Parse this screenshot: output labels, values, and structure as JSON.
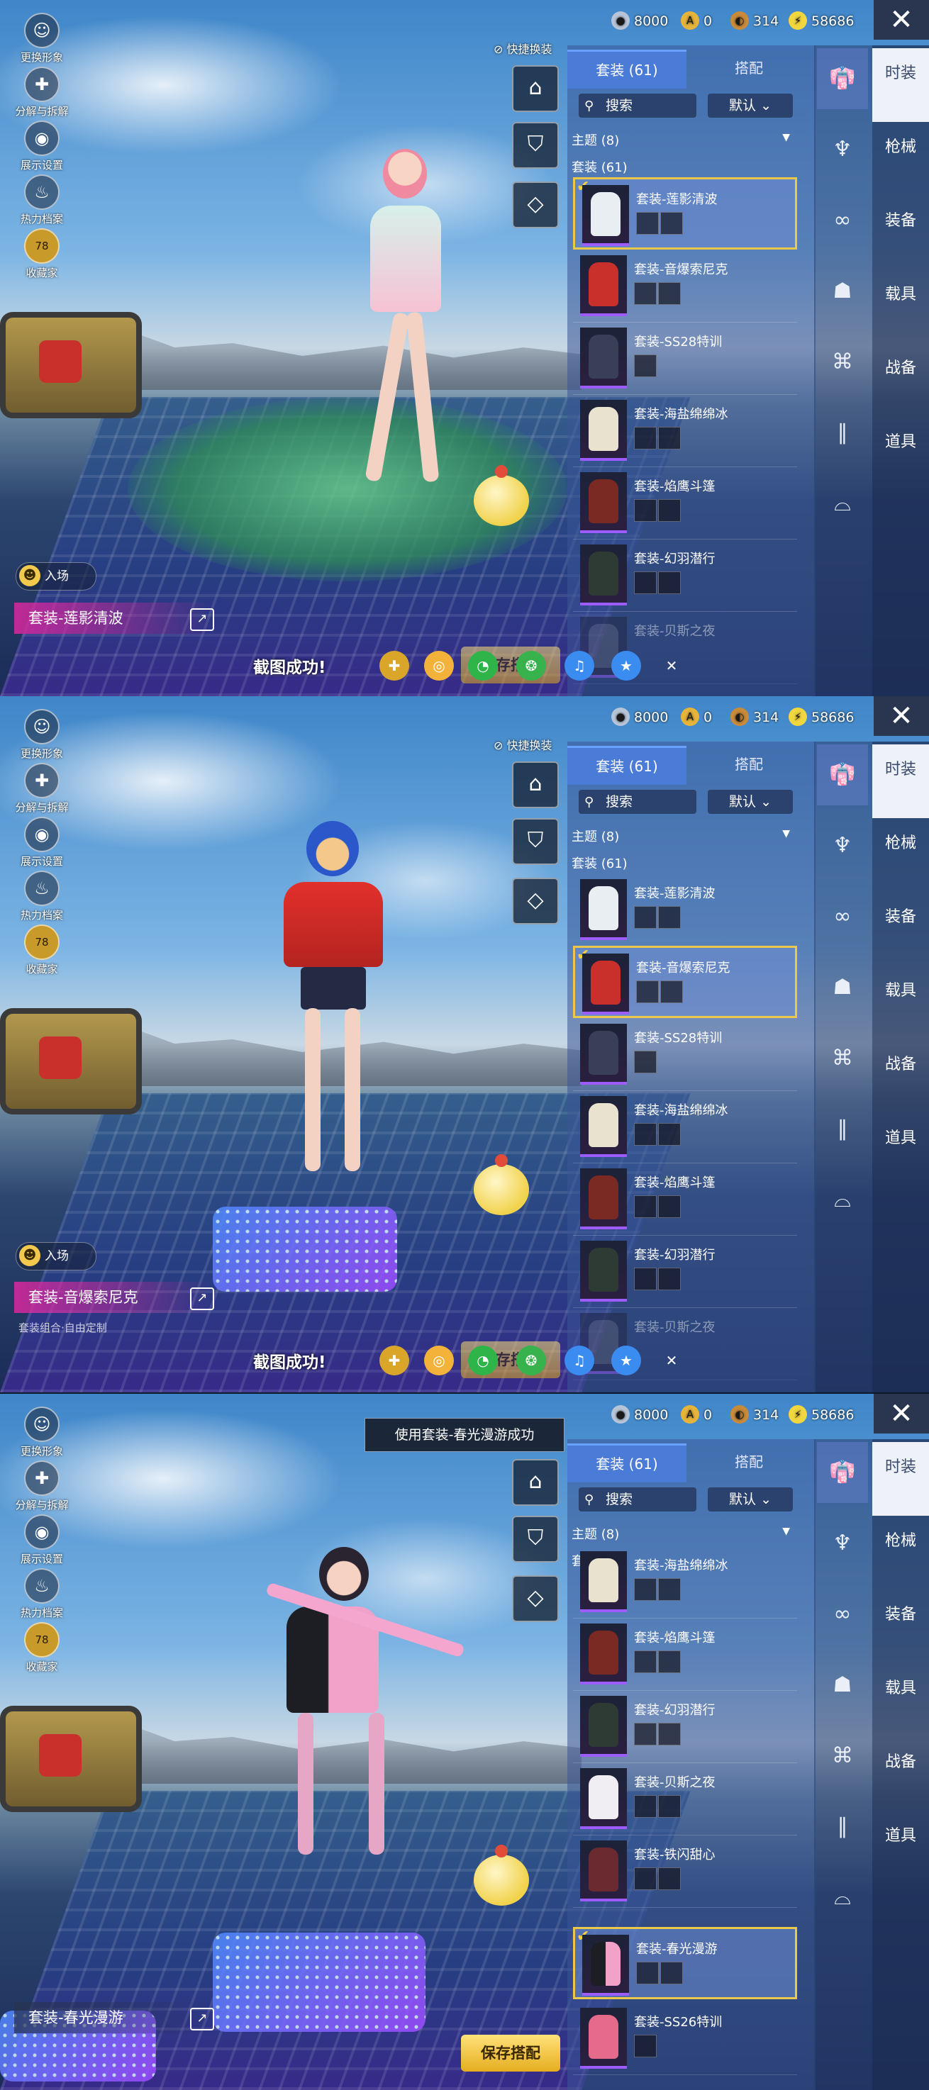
{
  "currency": {
    "coin": "8000",
    "badge": "0",
    "bronze": "314",
    "bolt": "58686"
  },
  "left_menu": [
    "更换形象",
    "分解与拆解",
    "展示设置",
    "热力档案",
    "收藏家"
  ],
  "collector_level": "78",
  "entry_label": "入场",
  "quick_change": "快捷换装",
  "tabs": [
    "套装 (61)",
    "搭配"
  ],
  "search_placeholder": "搜索",
  "sort_label": "默认",
  "theme_label": "主题 (8)",
  "suit_header": "套装 (61)",
  "side_nav": [
    "时装",
    "枪械",
    "装备",
    "载具",
    "战备",
    "道具"
  ],
  "screenshot_toast": "截图成功!",
  "save_label": "保存搭配",
  "success_toast": "使用套装-春光漫游成功",
  "subdesc": "套装组合·自由定制",
  "panels": [
    {
      "current_suit": "套装-莲影清波",
      "items": [
        "套装-莲影清波",
        "套装-音爆索尼克",
        "套装-SS28特训",
        "套装-海盐绵绵冰",
        "套装-焰鹰斗篷",
        "套装-幻羽潜行",
        "套装-贝斯之夜"
      ]
    },
    {
      "current_suit": "套装-音爆索尼克",
      "items": [
        "套装-莲影清波",
        "套装-音爆索尼克",
        "套装-SS28特训",
        "套装-海盐绵绵冰",
        "套装-焰鹰斗篷",
        "套装-幻羽潜行",
        "套装-贝斯之夜"
      ]
    },
    {
      "current_suit": "套装-春光漫游",
      "items": [
        "套装-海盐绵绵冰",
        "套装-焰鹰斗篷",
        "套装-幻羽潜行",
        "套装-贝斯之夜",
        "套装-铁闪甜心",
        "套装-春光漫游",
        "套装-SS26特训"
      ]
    }
  ]
}
